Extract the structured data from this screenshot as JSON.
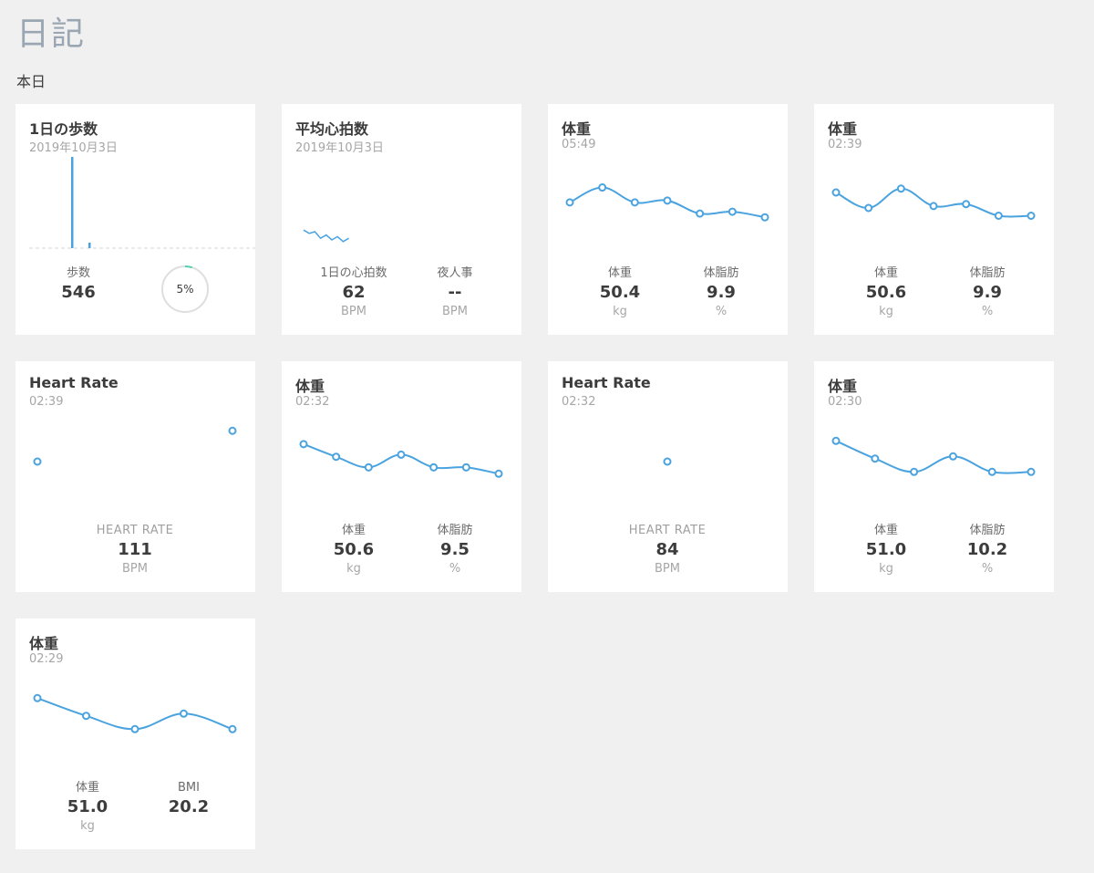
{
  "page": {
    "title": "日記",
    "section": "本日"
  },
  "cards": [
    {
      "kind": "steps",
      "title": "1日の歩数",
      "subtitle": "2019年10月3日",
      "metrics": [
        {
          "label": "歩数",
          "value": "546",
          "unit": ""
        }
      ],
      "goal_percent_label": "5%",
      "goal_fraction": 0.05,
      "chart_data": {
        "type": "bar",
        "values": [
          100,
          6
        ],
        "ylim": [
          0,
          100
        ]
      }
    },
    {
      "kind": "heart_avg",
      "title": "平均心拍数",
      "subtitle": "2019年10月3日",
      "metrics": [
        {
          "label": "1日の心拍数",
          "value": "62",
          "unit": "BPM"
        },
        {
          "label": "夜人事",
          "value": "--",
          "unit": "BPM"
        }
      ],
      "chart_data": {
        "type": "line",
        "values": [
          66,
          64,
          65,
          61,
          63,
          60,
          62,
          59,
          61
        ],
        "ylim": [
          40,
          90
        ]
      }
    },
    {
      "kind": "weight",
      "title": "体重",
      "subtitle": "05:49",
      "metrics": [
        {
          "label": "体重",
          "value": "50.4",
          "unit": "kg"
        },
        {
          "label": "体脂肪",
          "value": "9.9",
          "unit": "%"
        }
      ],
      "chart_data": {
        "type": "line",
        "values": [
          50.9,
          51.3,
          50.9,
          50.95,
          50.6,
          50.65,
          50.5
        ],
        "ylim": [
          49.5,
          52
        ]
      }
    },
    {
      "kind": "weight",
      "title": "体重",
      "subtitle": "02:39",
      "metrics": [
        {
          "label": "体重",
          "value": "50.6",
          "unit": "kg"
        },
        {
          "label": "体脂肪",
          "value": "9.9",
          "unit": "%"
        }
      ],
      "chart_data": {
        "type": "line",
        "values": [
          51.2,
          50.8,
          51.3,
          50.85,
          50.9,
          50.6,
          50.6
        ],
        "ylim": [
          49.6,
          52
        ]
      }
    },
    {
      "kind": "heart",
      "title": "Heart Rate",
      "subtitle": "02:39",
      "metrics": [
        {
          "label": "HEART RATE",
          "value": "111",
          "unit": "BPM"
        }
      ],
      "chart_data": {
        "type": "scatter",
        "values": [
          84,
          111
        ],
        "ylim": [
          40,
          120
        ]
      }
    },
    {
      "kind": "weight",
      "title": "体重",
      "subtitle": "02:32",
      "metrics": [
        {
          "label": "体重",
          "value": "50.6",
          "unit": "kg"
        },
        {
          "label": "体脂肪",
          "value": "9.5",
          "unit": "%"
        }
      ],
      "chart_data": {
        "type": "line",
        "values": [
          51.4,
          51.1,
          50.85,
          51.15,
          50.85,
          50.85,
          50.7
        ],
        "ylim": [
          49.8,
          52
        ]
      }
    },
    {
      "kind": "heart",
      "title": "Heart Rate",
      "subtitle": "02:32",
      "metrics": [
        {
          "label": "HEART RATE",
          "value": "84",
          "unit": "BPM"
        }
      ],
      "chart_data": {
        "type": "scatter",
        "values": [
          84
        ],
        "ylim": [
          40,
          120
        ],
        "single": true
      }
    },
    {
      "kind": "weight",
      "title": "体重",
      "subtitle": "02:30",
      "metrics": [
        {
          "label": "体重",
          "value": "51.0",
          "unit": "kg"
        },
        {
          "label": "体脂肪",
          "value": "10.2",
          "unit": "%"
        }
      ],
      "chart_data": {
        "type": "line",
        "values": [
          51.5,
          51.1,
          50.8,
          51.15,
          50.8,
          50.8
        ],
        "ylim": [
          49.9,
          52
        ]
      }
    },
    {
      "kind": "weight_bmi",
      "title": "体重",
      "subtitle": "02:29",
      "metrics": [
        {
          "label": "体重",
          "value": "51.0",
          "unit": "kg"
        },
        {
          "label": "BMI",
          "value": "20.2",
          "unit": ""
        }
      ],
      "chart_data": {
        "type": "line",
        "values": [
          51.5,
          51.1,
          50.8,
          51.15,
          50.8
        ],
        "ylim": [
          49.9,
          52
        ]
      }
    }
  ]
}
